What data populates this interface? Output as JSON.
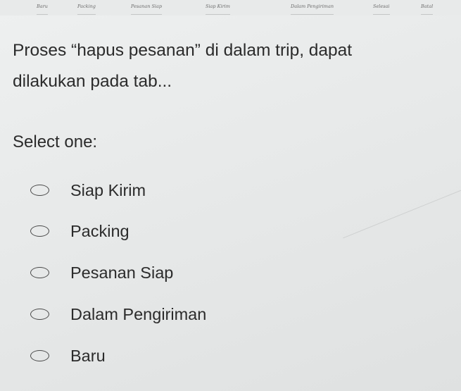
{
  "tabs": [
    "Baru",
    "Packing",
    "Pesanan Siap",
    "Siap Kirim",
    "Dalam Pengiriman",
    "Selesai",
    "Batal"
  ],
  "question": {
    "line1": "Proses “hapus pesanan” di dalam trip, dapat",
    "line2": "dilakukan pada tab..."
  },
  "select_label": "Select one:",
  "options": [
    {
      "label": "Siap Kirim",
      "selected": false
    },
    {
      "label": "Packing",
      "selected": false
    },
    {
      "label": "Pesanan Siap",
      "selected": false
    },
    {
      "label": "Dalam Pengiriman",
      "selected": false
    },
    {
      "label": "Baru",
      "selected": false
    }
  ]
}
